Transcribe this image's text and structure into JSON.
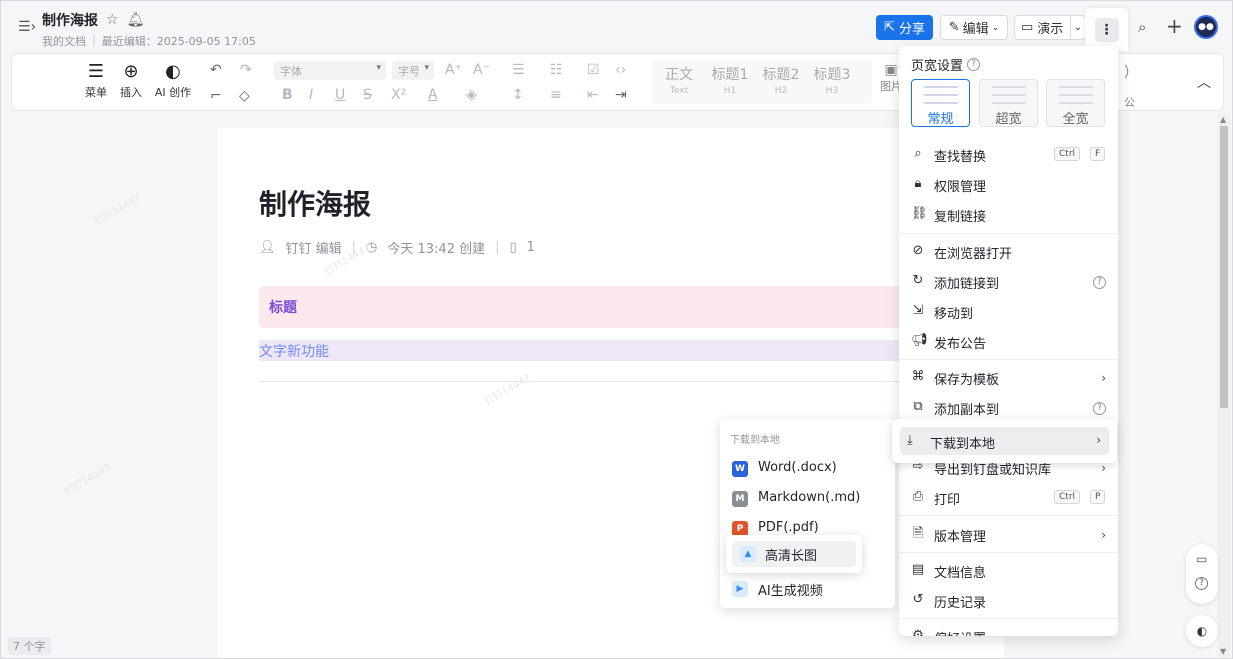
{
  "header": {
    "title": "制作海报",
    "location": "我的文档",
    "last_edit": "最近编辑：2025-09-05 17:05",
    "share_label": "分享",
    "edit_label": "编辑",
    "present_label": "演示"
  },
  "toolbar": {
    "menu_label": "菜单",
    "insert_label": "插入",
    "ai_label": "AI 创作",
    "font_placeholder": "字体",
    "size_placeholder": "字号",
    "style_body": "正文",
    "style_body_sub": "Text",
    "style_h1": "标题1",
    "style_h1_sub": "H1",
    "style_h2": "标题2",
    "style_h2_sub": "H2",
    "style_h3": "标题3",
    "style_h3_sub": "H3",
    "image_label": "图片",
    "ghost_right": "）",
    "ghost_right2": "公"
  },
  "doc": {
    "title": "制作海报",
    "author": "钉钉 编辑",
    "created": "今天 13:42 创建",
    "reads": "1",
    "callout": "标题",
    "highlight_text": "文字新功能",
    "word_count": "7 个字",
    "watermark": "钉钉14447"
  },
  "menu": {
    "page_width_label": "页宽设置",
    "width_options": [
      "常规",
      "超宽",
      "全宽"
    ],
    "find_replace": "查找替换",
    "find_kbd1": "Ctrl",
    "find_kbd2": "F",
    "permissions": "权限管理",
    "copy_link": "复制链接",
    "open_browser": "在浏览器打开",
    "add_link_to": "添加链接到",
    "move_to": "移动到",
    "publish": "发布公告",
    "save_template": "保存为模板",
    "add_copy_to": "添加副本到",
    "download": "下载到本地",
    "export": "导出到钉盘或知识库",
    "print": "打印",
    "print_kbd1": "Ctrl",
    "print_kbd2": "P",
    "version": "版本管理",
    "doc_info": "文档信息",
    "history": "历史记录",
    "more_settings": "偏好设置"
  },
  "submenu": {
    "header": "下载到本地",
    "word": "Word(.docx)",
    "markdown": "Markdown(.md)",
    "pdf": "PDF(.pdf)",
    "long_image": "高清长图",
    "ai_video": "AI生成视频"
  },
  "colors": {
    "accent": "#1a73e8",
    "callout_bg": "#fbe9ee",
    "highlight_bg": "#efe7f7"
  }
}
